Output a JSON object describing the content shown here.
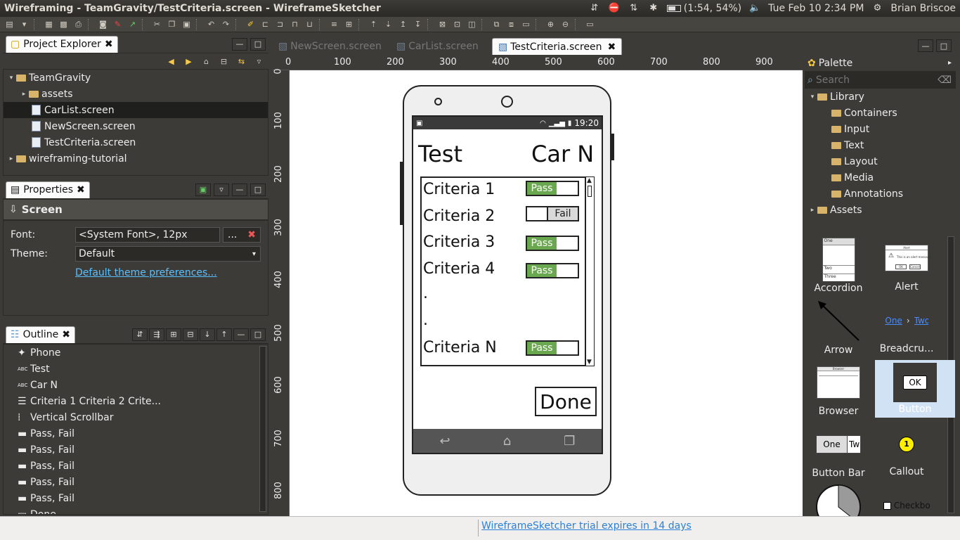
{
  "window": {
    "title": "Wireframing - TeamGravity/TestCriteria.screen - WireframeSketcher"
  },
  "tray": {
    "battery": "(1:54, 54%)",
    "datetime": "Tue Feb 10  2:34 PM",
    "user": "Brian Briscoe"
  },
  "project_explorer": {
    "title": "Project Explorer",
    "tree": [
      {
        "label": "TeamGravity",
        "type": "project",
        "expanded": true
      },
      {
        "label": "assets",
        "type": "folder"
      },
      {
        "label": "CarList.screen",
        "type": "file",
        "selected": true
      },
      {
        "label": "NewScreen.screen",
        "type": "file"
      },
      {
        "label": "TestCriteria.screen",
        "type": "file"
      },
      {
        "label": "wireframing-tutorial",
        "type": "project",
        "expanded": false
      }
    ]
  },
  "properties": {
    "title": "Properties",
    "heading": "Screen",
    "font_label": "Font:",
    "font_value": "<System Font>, 12px",
    "font_btn": "...",
    "theme_label": "Theme:",
    "theme_value": "Default",
    "theme_link": "Default theme preferences..."
  },
  "outline": {
    "title": "Outline",
    "items": [
      "Phone",
      "Test",
      "Car N",
      "Criteria 1 Criteria 2 Crite...",
      "Vertical Scrollbar",
      "Pass, Fail",
      "Pass, Fail",
      "Pass, Fail",
      "Pass, Fail",
      "Pass, Fail",
      "Done"
    ]
  },
  "editor": {
    "tabs": [
      {
        "label": "NewScreen.screen",
        "active": false
      },
      {
        "label": "CarList.screen",
        "active": false
      },
      {
        "label": "TestCriteria.screen",
        "active": true
      }
    ],
    "ruler_h": [
      "0",
      "100",
      "200",
      "300",
      "400",
      "500",
      "600",
      "700",
      "800",
      "900"
    ],
    "ruler_v": [
      "0",
      "100",
      "200",
      "300",
      "400",
      "500",
      "600",
      "700",
      "800"
    ]
  },
  "mockup": {
    "status_time": "19:20",
    "title_left": "Test",
    "title_right": "Car N",
    "rows": [
      {
        "label": "Criteria 1",
        "state": "Pass"
      },
      {
        "label": "Criteria 2",
        "state": "Fail"
      },
      {
        "label": "Criteria 3",
        "state": "Pass"
      },
      {
        "label": "Criteria 4",
        "state": "Pass"
      },
      {
        "label": ".",
        "state": ""
      },
      {
        "label": ".",
        "state": ""
      },
      {
        "label": "Criteria N",
        "state": "Pass"
      }
    ],
    "done": "Done"
  },
  "palette": {
    "title": "Palette",
    "search_placeholder": "Search",
    "library": "Library",
    "folders": [
      "Containers",
      "Input",
      "Text",
      "Layout",
      "Media",
      "Annotations"
    ],
    "assets": "Assets",
    "items": [
      "Accordion",
      "Alert",
      "Arrow",
      "Breadcru...",
      "Browser",
      "Button",
      "Button Bar",
      "Callout",
      "",
      "Checkbo"
    ],
    "thumb_text": {
      "accordion": [
        "One",
        "Two",
        "Three"
      ],
      "alert_title": "Alert",
      "alert_msg": "This is an alert message.",
      "alert_ok": "OK",
      "alert_cancel": "Cancel",
      "breadcrumb_one": "One",
      "breadcrumb_two": "Two",
      "browser_title": "Browser",
      "button_ok": "OK",
      "bbar_one": "One",
      "bbar_two": "Tw",
      "callout_num": "1"
    }
  },
  "status": {
    "trial": "WireframeSketcher trial expires in 14 days"
  }
}
